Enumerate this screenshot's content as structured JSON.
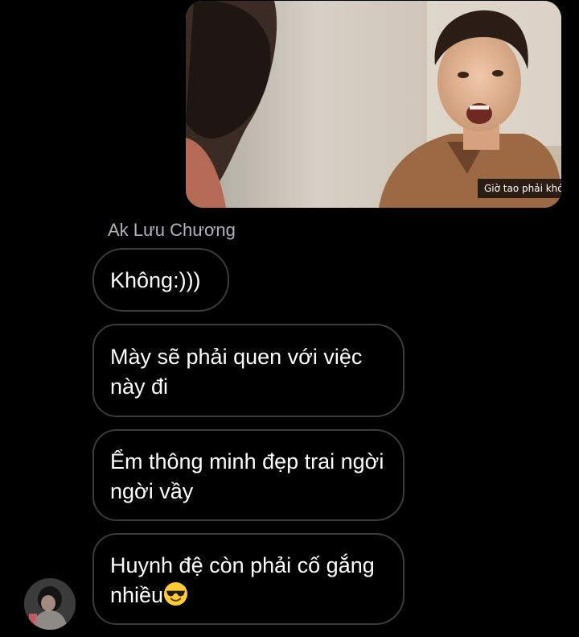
{
  "thread": {
    "image_message": {
      "subtitle": "Giờ tao phải khóc đúng không?"
    },
    "sender_name": "Ak Lưu Chương",
    "messages": [
      {
        "text": "Không:)))"
      },
      {
        "text": "Mày sẽ phải quen với việc này đi"
      },
      {
        "text": "Ểm thông minh đẹp trai ngời ngời vầy"
      },
      {
        "text": "Huynh đệ còn phải cố gắng nhiều",
        "emoji": "smiling-face-with-sunglasses-icon"
      }
    ]
  },
  "theme": {
    "background": "#000000",
    "bubble_border": "#3a3b3c",
    "text": "#ffffff",
    "sender_name_color": "#b0b3b8"
  }
}
